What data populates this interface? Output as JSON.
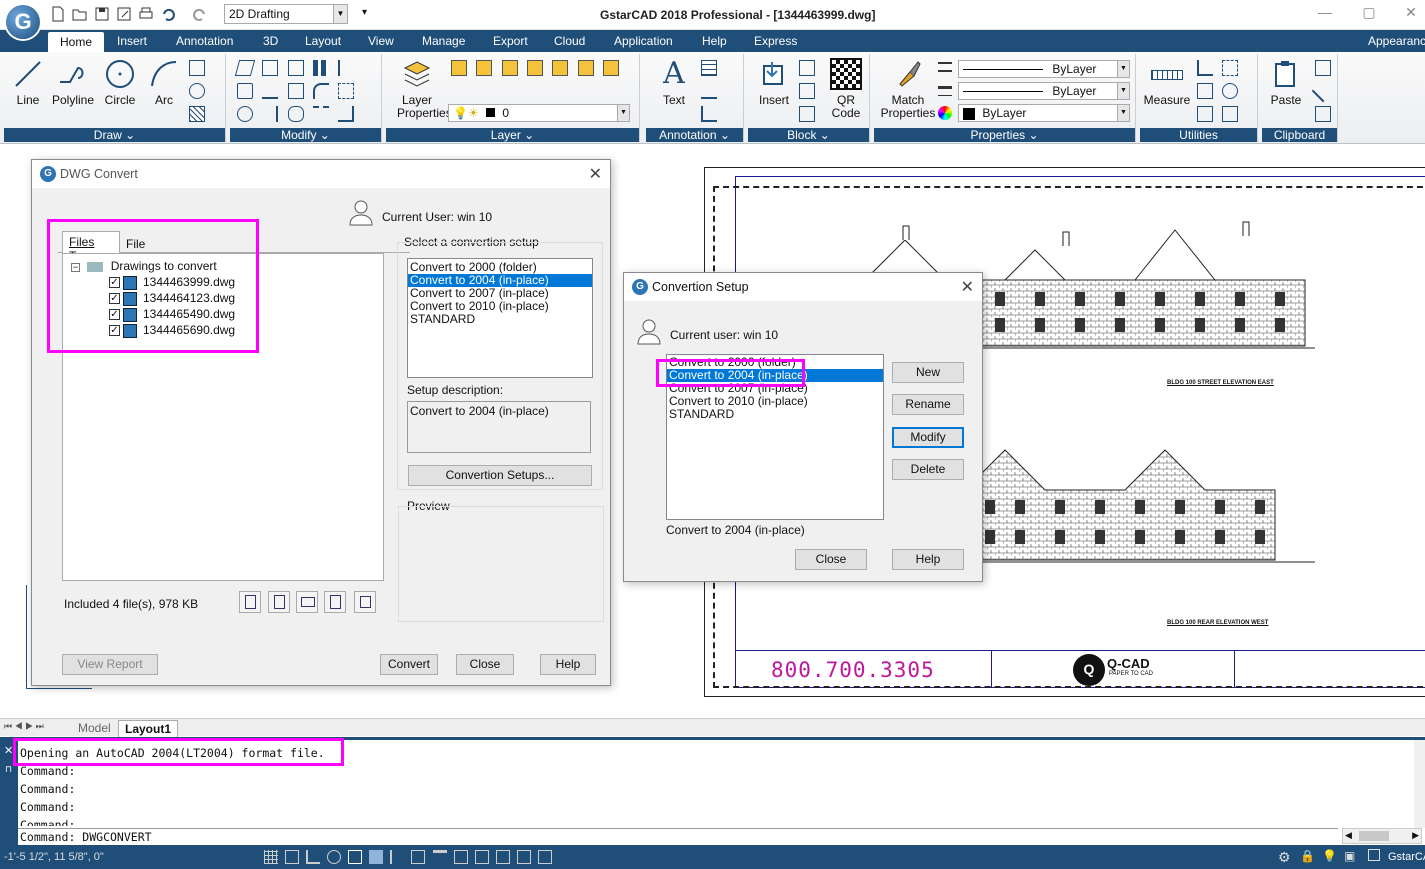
{
  "app": {
    "logo_letter": "G",
    "window_title": "GstarCAD 2018 Professional - [1344463999.dwg]",
    "workspace": "2D Drafting",
    "window_controls": [
      "—",
      "▢",
      "✕"
    ]
  },
  "ribbon": {
    "tabs": [
      "Home",
      "Insert",
      "Annotation",
      "3D",
      "Layout",
      "View",
      "Manage",
      "Export",
      "Cloud",
      "Application",
      "Help",
      "Express",
      "Appearance"
    ],
    "active_tab": "Home",
    "panels": {
      "draw": {
        "title": "Draw ⌄",
        "tools": [
          "Line",
          "Polyline",
          "Circle",
          "Arc"
        ]
      },
      "modify": {
        "title": "Modify ⌄"
      },
      "layer": {
        "title": "Layer ⌄",
        "tool": "Layer Properties",
        "current_layer": "0"
      },
      "annotation": {
        "title": "Annotation ⌄",
        "tool": "Text"
      },
      "block": {
        "title": "Block ⌄",
        "tools": [
          "Insert",
          "QR Code"
        ]
      },
      "properties": {
        "title": "Properties ⌄",
        "tool": "Match Properties",
        "linetype": "ByLayer",
        "lineweight": "ByLayer",
        "color": "ByLayer"
      },
      "utilities": {
        "title": "Utilities",
        "tool": "Measure"
      },
      "clipboard": {
        "title": "Clipboard",
        "tool": "Paste"
      }
    }
  },
  "dwg_convert": {
    "title": "DWG Convert",
    "current_user_label": "Current User:  win 10",
    "tabs": [
      "Files Tree",
      "File Table"
    ],
    "tree_root": "Drawings to convert",
    "files": [
      "1344463999.dwg",
      "1344464123.dwg",
      "1344465490.dwg",
      "1344465690.dwg"
    ],
    "summary": "Included 4 file(s), 978 KB",
    "select_setup_label": "Select a convertion setup",
    "setups": [
      "Convert to 2000 (folder)",
      "Convert to 2004 (in-place)",
      "Convert to 2007 (in-place)",
      "Convert to 2010 (in-place)",
      "STANDARD"
    ],
    "selected_setup_index": 1,
    "setup_description_label": "Setup description:",
    "setup_description": "Convert to 2004 (in-place)",
    "convertion_setups_button": "Convertion Setups...",
    "preview_label": "Preview",
    "buttons": {
      "view_report": "View Report",
      "convert": "Convert",
      "close": "Close",
      "help": "Help"
    }
  },
  "convertion_setup": {
    "title": "Convertion Setup",
    "current_user_label": "Current user: win 10",
    "setups": [
      "Convert to 2000 (folder)",
      "Convert to 2004 (in-place)",
      "Convert to 2007 (in-place)",
      "Convert to 2010 (in-place)",
      "STANDARD"
    ],
    "selected_index": 1,
    "selected_description": "Convert to 2004 (in-place)",
    "buttons": {
      "new": "New",
      "rename": "Rename",
      "modify": "Modify",
      "delete": "Delete",
      "close": "Close",
      "help": "Help"
    }
  },
  "drawing": {
    "elevation_east": "BLDG 100 STREET ELEVATION EAST",
    "elevation_west": "BLDG 100 REAR ELEVATION WEST",
    "phone": "800.700.3305",
    "brand": "Q-CAD",
    "brand_tagline": "PAPER TO CAD"
  },
  "layout_tabs": [
    "Model",
    "Layout1"
  ],
  "active_layout": "Layout1",
  "command_history": [
    "Opening an AutoCAD 2004(LT2004) format file.",
    "Command:",
    "Command:",
    "Command:",
    "Command:"
  ],
  "command_input": "Command: DWGCONVERT",
  "status": {
    "coordinates": "-1'-5 1/2\", 11 5/8\", 0\"",
    "right_label": "GstarCA"
  },
  "colors": {
    "ribbon_blue": "#1f4e79",
    "selection": "#0078d7",
    "highlight": "#ff00ff",
    "phone_magenta": "#c0169c"
  }
}
